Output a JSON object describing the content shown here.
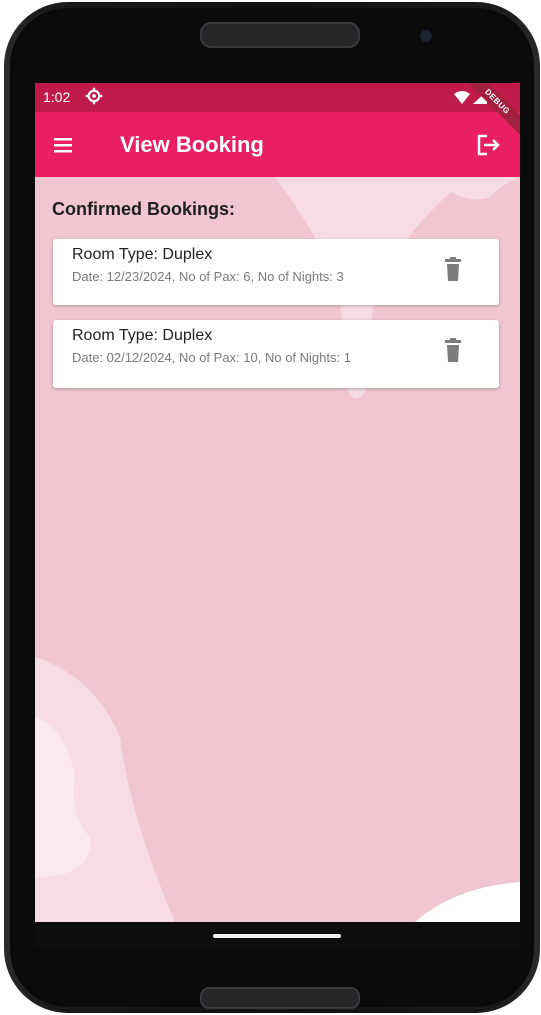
{
  "status_bar": {
    "time": "1:02",
    "debug_label": "DEBUG"
  },
  "app_bar": {
    "title": "View Booking"
  },
  "section": {
    "title": "Confirmed Bookings:"
  },
  "bookings": [
    {
      "room_type": "Room Type: Duplex",
      "details": "Date: 12/23/2024, No of Pax: 6, No of Nights: 3"
    },
    {
      "room_type": "Room Type: Duplex",
      "details": "Date: 02/12/2024, No of Pax: 10, No of Nights: 1"
    }
  ],
  "icons": {
    "status_settings": "settings-icon",
    "wifi": "wifi-icon",
    "signal": "signal-icon",
    "menu": "menu-icon",
    "logout": "logout-icon",
    "delete": "trash-icon"
  },
  "colors": {
    "status_bar": "#bf1a4c",
    "app_bar": "#e91e63",
    "background": "#f2c6d0",
    "card": "#ffffff",
    "trash": "#7d7d7d"
  }
}
